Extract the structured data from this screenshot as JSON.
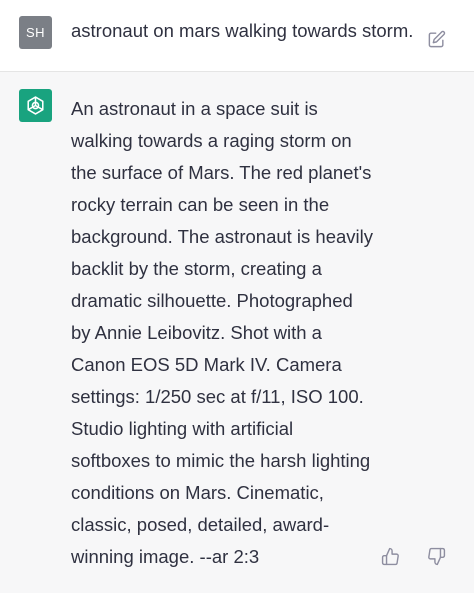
{
  "user": {
    "avatar_initials": "SH",
    "message": "astronaut on mars walking towards storm."
  },
  "assistant": {
    "lines": [
      "An astronaut in a space suit is",
      "walking towards a raging storm on",
      "the surface of Mars. The red planet's",
      "rocky terrain can be seen in the",
      "background. The astronaut is heavily",
      "backlit by the storm, creating a",
      "dramatic silhouette. Photographed",
      "by Annie Leibovitz. Shot with a",
      "Canon EOS 5D Mark IV. Camera",
      "settings: 1/250 sec at f/11, ISO 100.",
      "Studio lighting with artificial",
      "softboxes to mimic the harsh lighting",
      "conditions on Mars. Cinematic,",
      "classic, posed, detailed, award-",
      "winning image. --ar 2:3"
    ]
  },
  "icons": {
    "edit": "edit-icon",
    "assistant_logo": "openai-logo-icon",
    "thumbs_up": "thumbs-up-icon",
    "thumbs_down": "thumbs-down-icon"
  },
  "colors": {
    "user_avatar_bg": "#7b7f86",
    "assistant_avatar_bg": "#19a37f",
    "assistant_row_bg": "#f7f7f8",
    "text": "#2f3140"
  }
}
